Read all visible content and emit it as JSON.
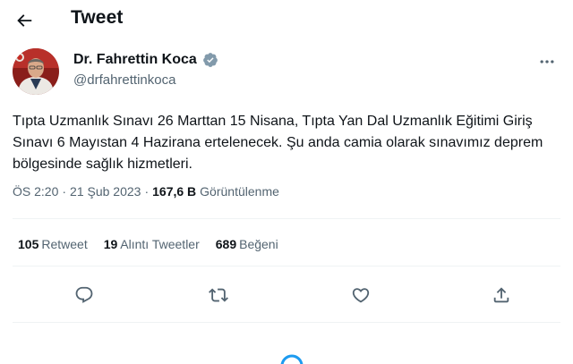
{
  "header": {
    "title": "Tweet",
    "back_icon": "arrow-left-icon"
  },
  "author": {
    "name": "Dr. Fahrettin Koca",
    "handle": "@drfahrettinkoca",
    "verified_icon": "verified-badge-icon",
    "verified_color": "#829aab"
  },
  "tweet": {
    "text": "Tıpta Uzmanlık Sınavı 26 Marttan 15 Nisana, Tıpta Yan Dal Uzmanlık Eğitimi Giriş Sınavı 6 Mayıstan 4 Hazirana ertelenecek. Şu anda camia olarak sınavımız deprem bölgesinde sağlık hizmetleri.",
    "time": "ÖS 2:20",
    "separator": "·",
    "date": "21 Şub 2023",
    "views_count": "167,6 B",
    "views_label": "Görüntülenme"
  },
  "stats": {
    "retweets_count": "105",
    "retweets_label": "Retweet",
    "quotes_count": "19",
    "quotes_label": "Alıntı Tweetler",
    "likes_count": "689",
    "likes_label": "Beğeni"
  },
  "actions": [
    {
      "name": "reply",
      "icon": "reply-icon"
    },
    {
      "name": "retweet",
      "icon": "retweet-icon"
    },
    {
      "name": "like",
      "icon": "heart-icon"
    },
    {
      "name": "share",
      "icon": "share-icon"
    }
  ],
  "colors": {
    "text_primary": "#0f1419",
    "text_secondary": "#536471",
    "divider": "#eff3f4",
    "accent": "#1d9bf0"
  }
}
